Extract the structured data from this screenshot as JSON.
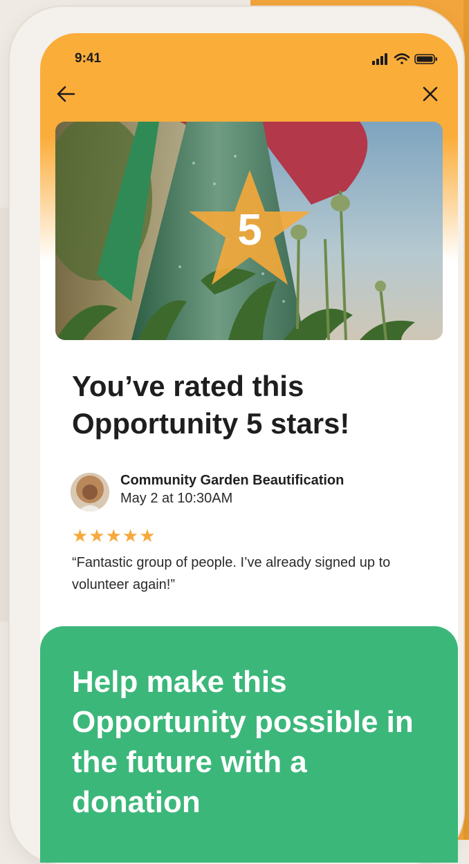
{
  "status_bar": {
    "time": "9:41"
  },
  "hero": {
    "rating_number": "5"
  },
  "confirmation": {
    "title": "You’ve rated this Opportunity 5 stars!"
  },
  "review": {
    "opportunity_name": "Community Garden Beautification",
    "date": "May 2 at 10:30AM",
    "stars_text": "★★★★★",
    "rating": 5,
    "quote": "“Fantastic group of people. I’ve already signed up to volunteer again!”"
  },
  "donate": {
    "text": "Help make this Opportunity possible in the future with a donation"
  },
  "colors": {
    "header_orange": "#fbad3a",
    "star_orange": "#f7a93b",
    "donate_green": "#3cb77a",
    "background_orange": "#f2a53c"
  },
  "icons": {
    "back": "arrow-left-icon",
    "close": "close-icon",
    "signal": "cellular-signal-icon",
    "wifi": "wifi-icon",
    "battery": "battery-icon"
  }
}
